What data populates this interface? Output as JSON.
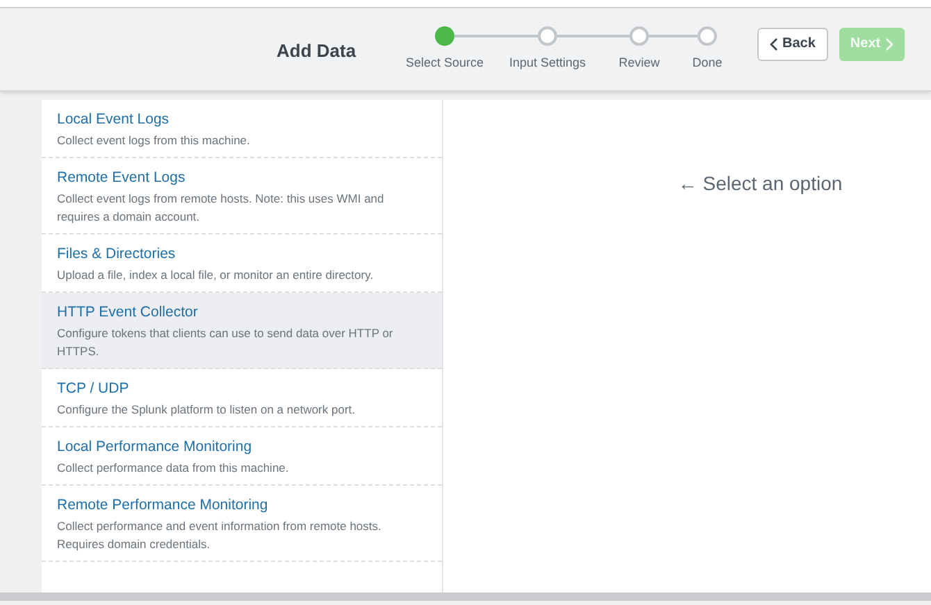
{
  "header": {
    "title": "Add Data",
    "steps": [
      {
        "label": "Select Source",
        "selected": true
      },
      {
        "label": "Input Settings",
        "selected": false
      },
      {
        "label": "Review",
        "selected": false
      },
      {
        "label": "Done",
        "selected": false
      }
    ],
    "buttons": [
      {
        "label": "Back",
        "disabled": false
      },
      {
        "label": "Next",
        "disabled": true
      }
    ]
  },
  "sources": [
    {
      "title": "Local Event Logs",
      "description": "Collect event logs from this machine.",
      "selected": false
    },
    {
      "title": "Remote Event Logs",
      "description": "Collect event logs from remote hosts. Note: this uses WMI and requires a domain account.",
      "selected": false
    },
    {
      "title": "Files & Directories",
      "description": "Upload a file, index a local file, or monitor an entire directory.",
      "selected": false
    },
    {
      "title": "HTTP Event Collector",
      "description": "Configure tokens that clients can use to send data over HTTP or HTTPS.",
      "selected": true
    },
    {
      "title": "TCP / UDP",
      "description": "Configure the Splunk platform to listen on a network port.",
      "selected": false
    },
    {
      "title": "Local Performance Monitoring",
      "description": "Collect performance data from this machine.",
      "selected": false
    },
    {
      "title": "Remote Performance Monitoring",
      "description": "Collect performance and event information from remote hosts. Requires domain credentials.",
      "selected": false
    }
  ],
  "detail": {
    "hint": "← Select an option"
  }
}
